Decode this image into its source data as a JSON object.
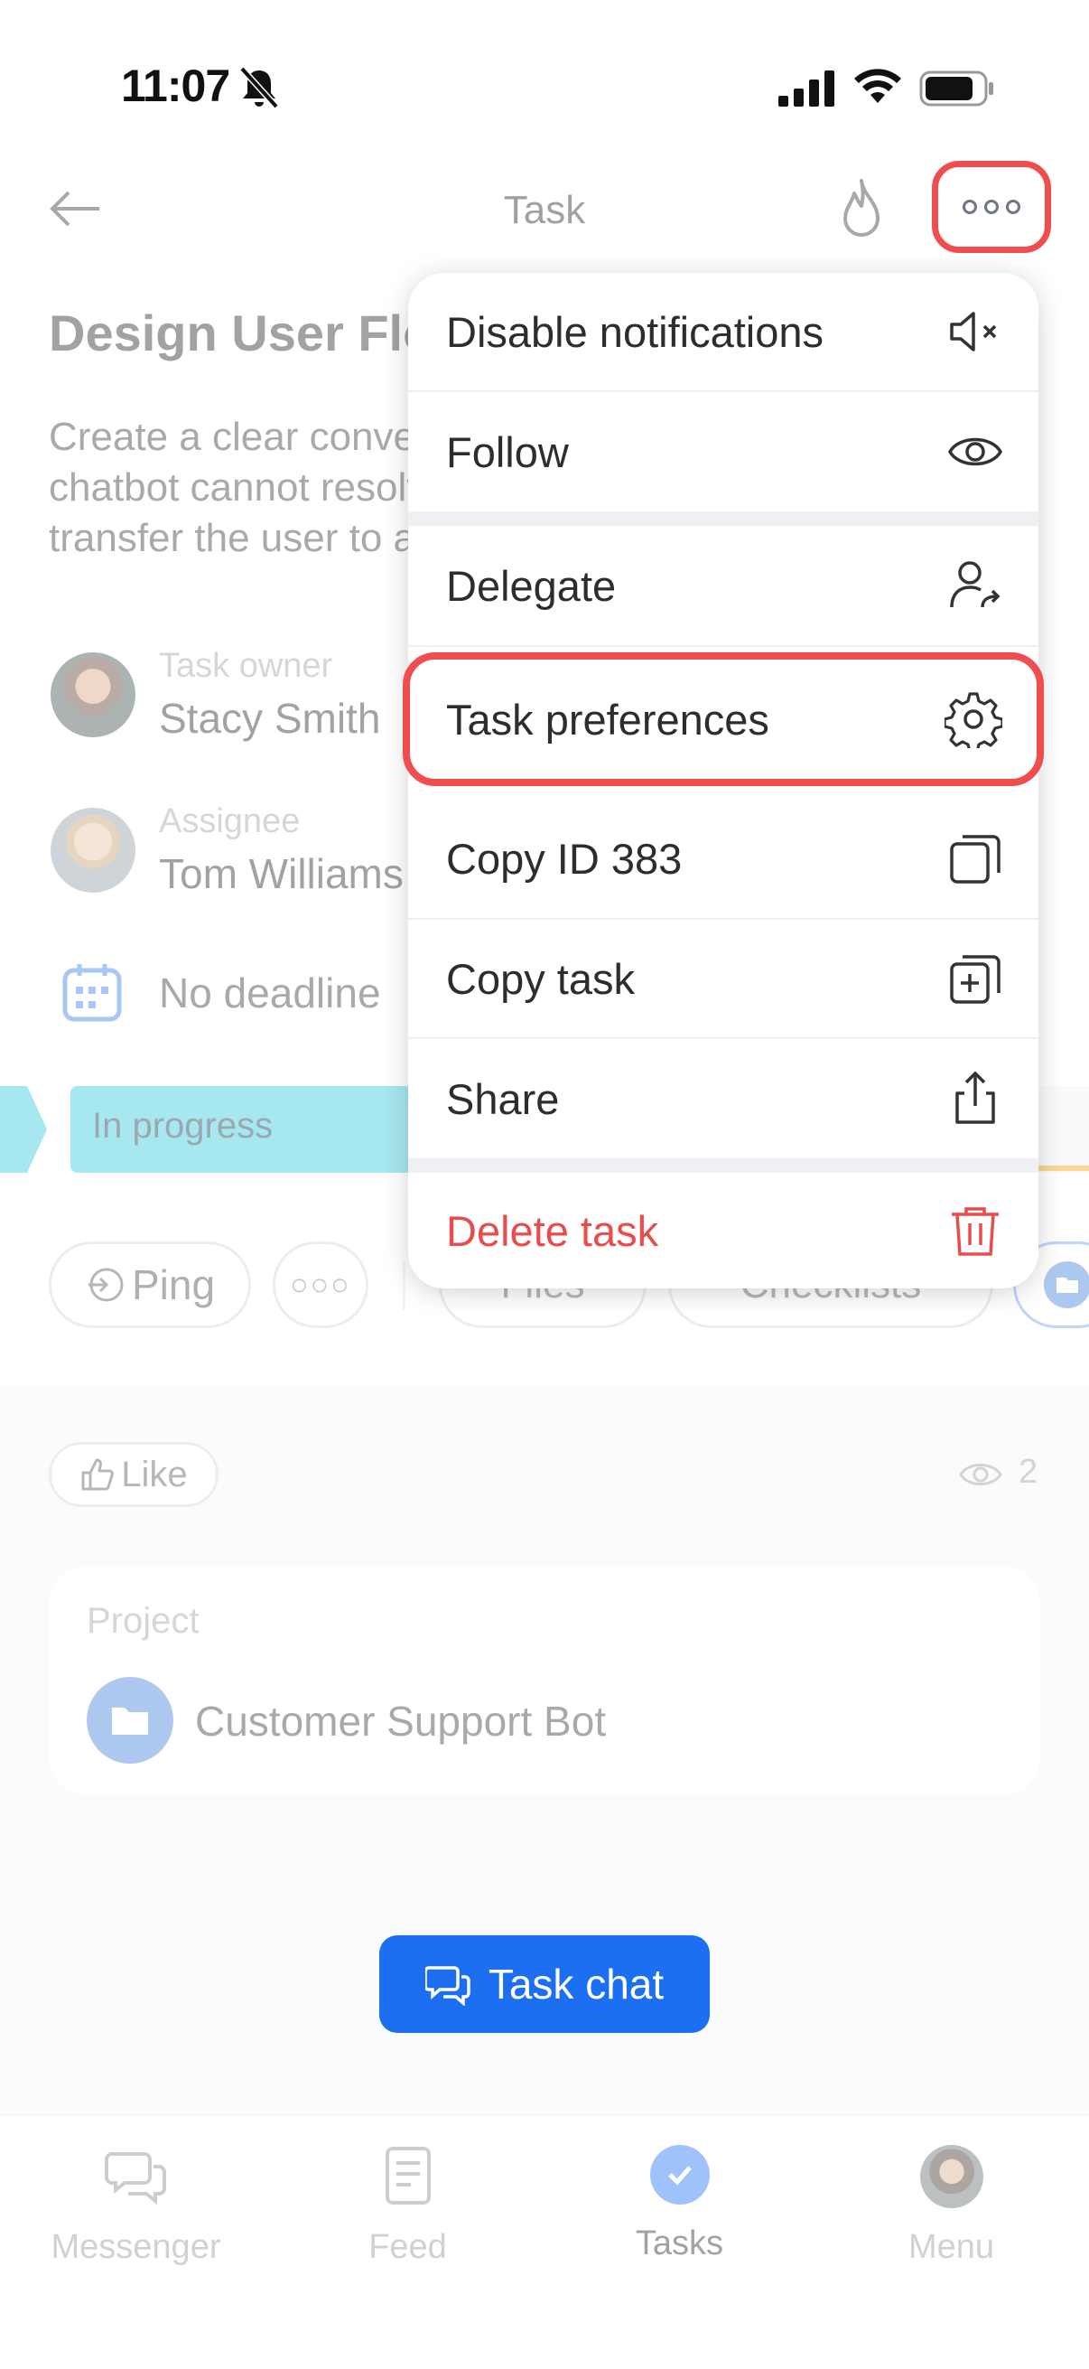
{
  "status_bar": {
    "time": "11:07"
  },
  "header": {
    "title": "Task"
  },
  "task": {
    "title": "Design User Flow",
    "description": "Create a clear conversation flow for cases when the chatbot cannot resolve the request and needs to transfer the user to a live agent.",
    "owner_label": "Task owner",
    "owner_name": "Stacy Smith",
    "assignee_label": "Assignee",
    "assignee_name": "Tom Williams",
    "deadline": "No deadline",
    "stage": "In progress"
  },
  "actions": {
    "ping": "Ping",
    "files": "Files",
    "checklists": "Checklists"
  },
  "social": {
    "like": "Like",
    "views": "2"
  },
  "project": {
    "label": "Project",
    "name": "Customer Support Bot"
  },
  "chat_button": "Task chat",
  "tabbar": {
    "messenger": "Messenger",
    "feed": "Feed",
    "tasks": "Tasks",
    "menu": "Menu"
  },
  "menu": {
    "disable_notifications": "Disable notifications",
    "follow": "Follow",
    "delegate": "Delegate",
    "task_preferences": "Task preferences",
    "copy_id": "Copy ID 383",
    "copy_task": "Copy task",
    "share": "Share",
    "delete_task": "Delete task"
  },
  "colors": {
    "accent": "#1d6ff2",
    "highlight": "#f04e4e",
    "stage": "#2fc6d8",
    "danger": "#e84d4d"
  }
}
